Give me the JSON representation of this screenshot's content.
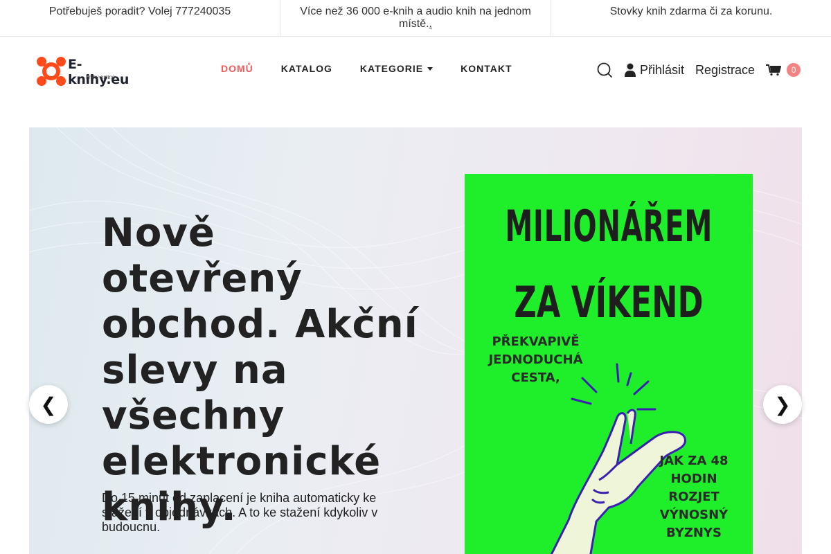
{
  "topbar": {
    "help": "Potřebuješ poradit? Volej 777240035",
    "catalog_info": "Více než 36 000 e-knih a audio knih na jednom místě.",
    "catalog_info_link": ".",
    "free_info": "Stovky knih zdarma či za korunu."
  },
  "logo": {
    "name": "E-knihy.eu",
    "tagline": "knihy online"
  },
  "nav": {
    "home": "DOMŮ",
    "catalog": "KATALOG",
    "categories": "KATEGORIE",
    "contact": "KONTAKT"
  },
  "actions": {
    "login": "Přihlásit",
    "register": "Registrace",
    "cart_count": "0"
  },
  "hero": {
    "title": "Nově otevřený obchod. Akční slevy na všechny elektronické knihy.",
    "subtitle": "Do 15 minut od zaplacení je kniha automaticky ke stažení v objednávkách. A to ke stažení kdykoliv v budoucnu.",
    "book": {
      "title_line1": "MILIONÁŘEM",
      "title_line2": "ZA VÍKEND",
      "subtitle": "PŘEKVAPIVĚ JEDNODUCHÁ CESTA,",
      "promise": "JAK ZA 48 HODIN ROZJET VÝNOSNÝ BYZNYS"
    },
    "prev_arrow": "❮",
    "next_arrow": "❯"
  },
  "colors": {
    "accent": "#f25a5a",
    "logo_orange": "#ff4a1c",
    "book_green": "#1fee2a",
    "cart_badge": "#f48383"
  }
}
